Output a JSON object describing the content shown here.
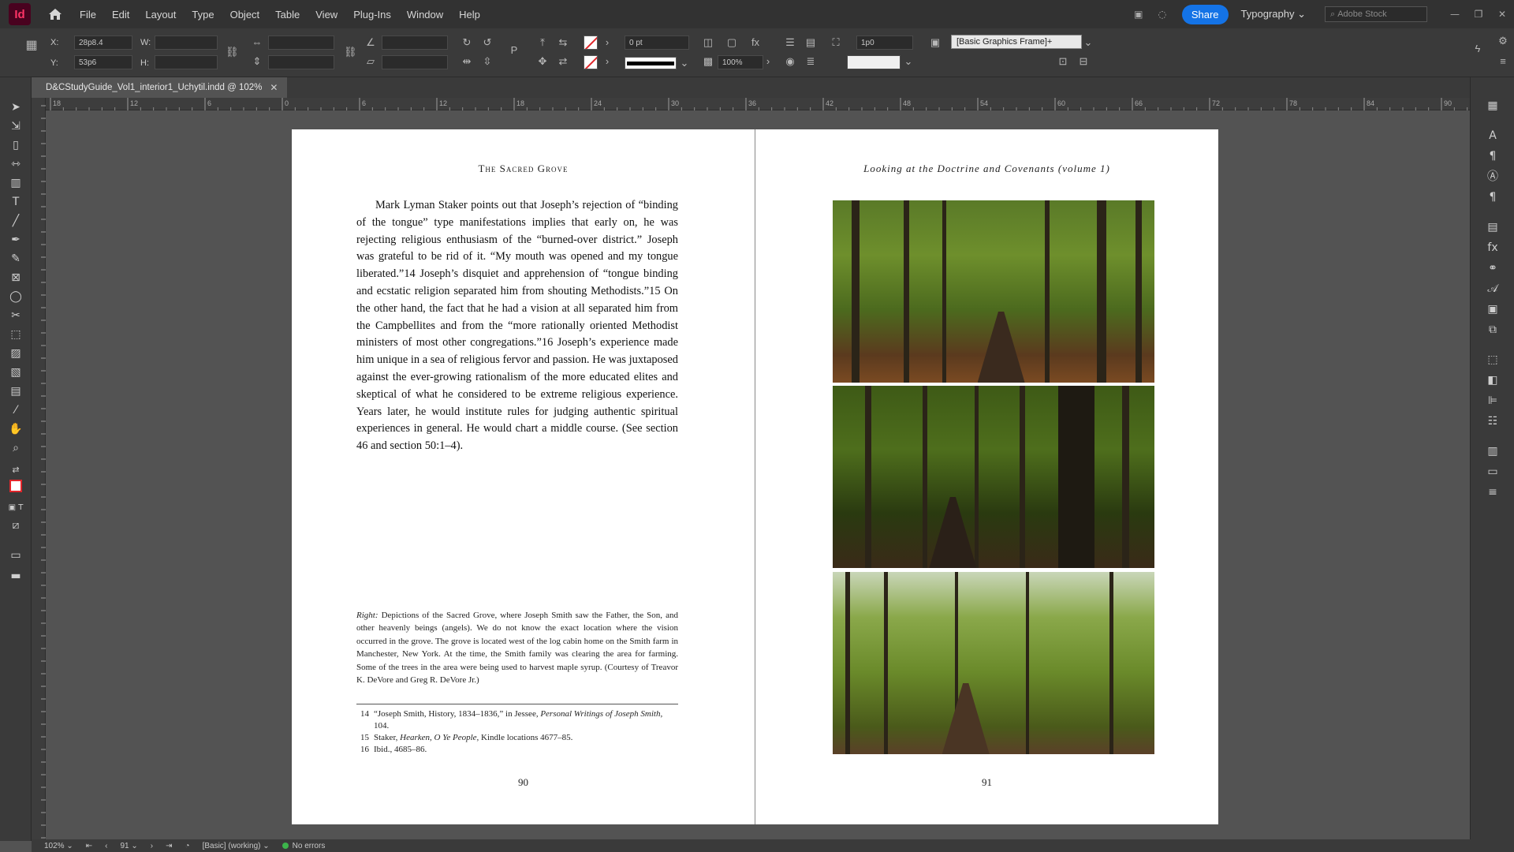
{
  "app": {
    "logo": "Id",
    "accent": "#ff3366",
    "share_color": "#1473e6"
  },
  "menu": [
    "File",
    "Edit",
    "Layout",
    "Type",
    "Object",
    "Table",
    "View",
    "Plug-Ins",
    "Window",
    "Help"
  ],
  "menubar_right": {
    "share_label": "Share",
    "workspace": "Typography",
    "stock_placeholder": "Adobe Stock"
  },
  "control": {
    "x_label": "X:",
    "x_value": "28p8.4",
    "y_label": "Y:",
    "y_value": "53p6",
    "w_label": "W:",
    "h_label": "H:",
    "stroke_weight": "0 pt",
    "opacity": "100%",
    "offset": "1p0",
    "object_style": "[Basic Graphics Frame]+"
  },
  "document_tab": {
    "title": "D&CStudyGuide_Vol1_interior1_Uchytil.indd @ 102%"
  },
  "ruler_marks": [
    "18",
    "12",
    "6",
    "0",
    "6",
    "12",
    "18",
    "24",
    "30",
    "36",
    "42",
    "48",
    "54",
    "60",
    "66",
    "72",
    "78",
    "84",
    "90"
  ],
  "left_page": {
    "running_head": "The Sacred Grove",
    "body": "Mark Lyman Staker points out that Joseph’s rejection of “binding of the tongue” type manifestations implies that early on, he was rejecting religious enthusiasm of the “burned-over district.” Joseph was grateful to be rid of it. “My mouth was opened and my tongue liberated.”14 Joseph’s disquiet and apprehension of “tongue binding and ecstatic religion separated him from shouting Methodists.”15 On the other hand, the fact that he had a vision at all separated him from the Campbellites and from the “more rationally oriented Methodist ministers of most other congregations.”16 Joseph’s experience made him unique in a sea of religious fervor and passion. He was juxtaposed against the ever-growing rationalism of the more educated elites and skeptical of what he considered to be extreme religious experience. Years later, he would institute rules for judging authentic spiritual experiences in general. He would chart a middle course. (See section 46 and section 50:1–4).",
    "caption_lead": "Right:",
    "caption": "Depictions of the Sacred Grove, where Joseph Smith saw the Father, the Son, and other heavenly beings (angels). We do not know the exact location where the vision occurred in the grove. The grove is located west of the log cabin home on the Smith farm in Manchester, New York. At the time, the Smith family was clearing the area for farming. Some of the trees in the area were being used to harvest maple syrup. (Courtesy of Treavor K. DeVore and Greg R. DeVore Jr.)",
    "footnotes": [
      {
        "num": "14",
        "text": "“Joseph Smith, History, 1834–1836,” in Jessee, ",
        "italic": "Personal Writings of Joseph Smith,",
        "after": "",
        "cont": "104."
      },
      {
        "num": "15",
        "text": "Staker, ",
        "italic": "Hearken, O Ye People,",
        "after": " Kindle locations 4677–85.",
        "cont": ""
      },
      {
        "num": "16",
        "text": "Ibid., 4685–86.",
        "italic": "",
        "after": "",
        "cont": ""
      }
    ],
    "folio": "90"
  },
  "right_page": {
    "running_head": "Looking at the Doctrine and Covenants (volume 1)",
    "folio": "91"
  },
  "status": {
    "zoom": "102%",
    "page": "91",
    "preflight_profile": "[Basic] (working)",
    "errors": "No errors"
  }
}
